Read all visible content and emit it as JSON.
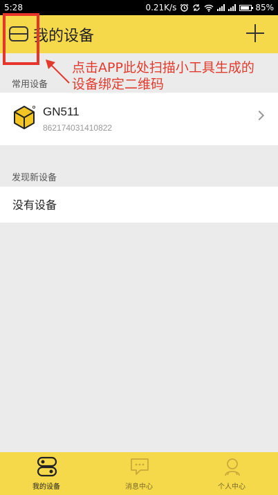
{
  "status_bar": {
    "time": "5:28",
    "speed": "0.21K/s",
    "battery": "85%",
    "battery_level": 0.85
  },
  "header": {
    "title": "我的设备"
  },
  "annotation": {
    "line1": "点击APP此处扫描小工具生成的",
    "line2": "设备绑定二维码",
    "color": "#e43a2d"
  },
  "sections": {
    "common_label": "常用设备",
    "discover_label": "发现新设备"
  },
  "devices": [
    {
      "name": "GN511",
      "id": "862174031410822"
    }
  ],
  "discover": {
    "empty_text": "没有设备"
  },
  "tabs": [
    {
      "label": "我的设备",
      "active": true
    },
    {
      "label": "消息中心",
      "active": false
    },
    {
      "label": "个人中心",
      "active": false
    }
  ],
  "colors": {
    "accent": "#f6d94a",
    "highlight": "#e7352c"
  }
}
